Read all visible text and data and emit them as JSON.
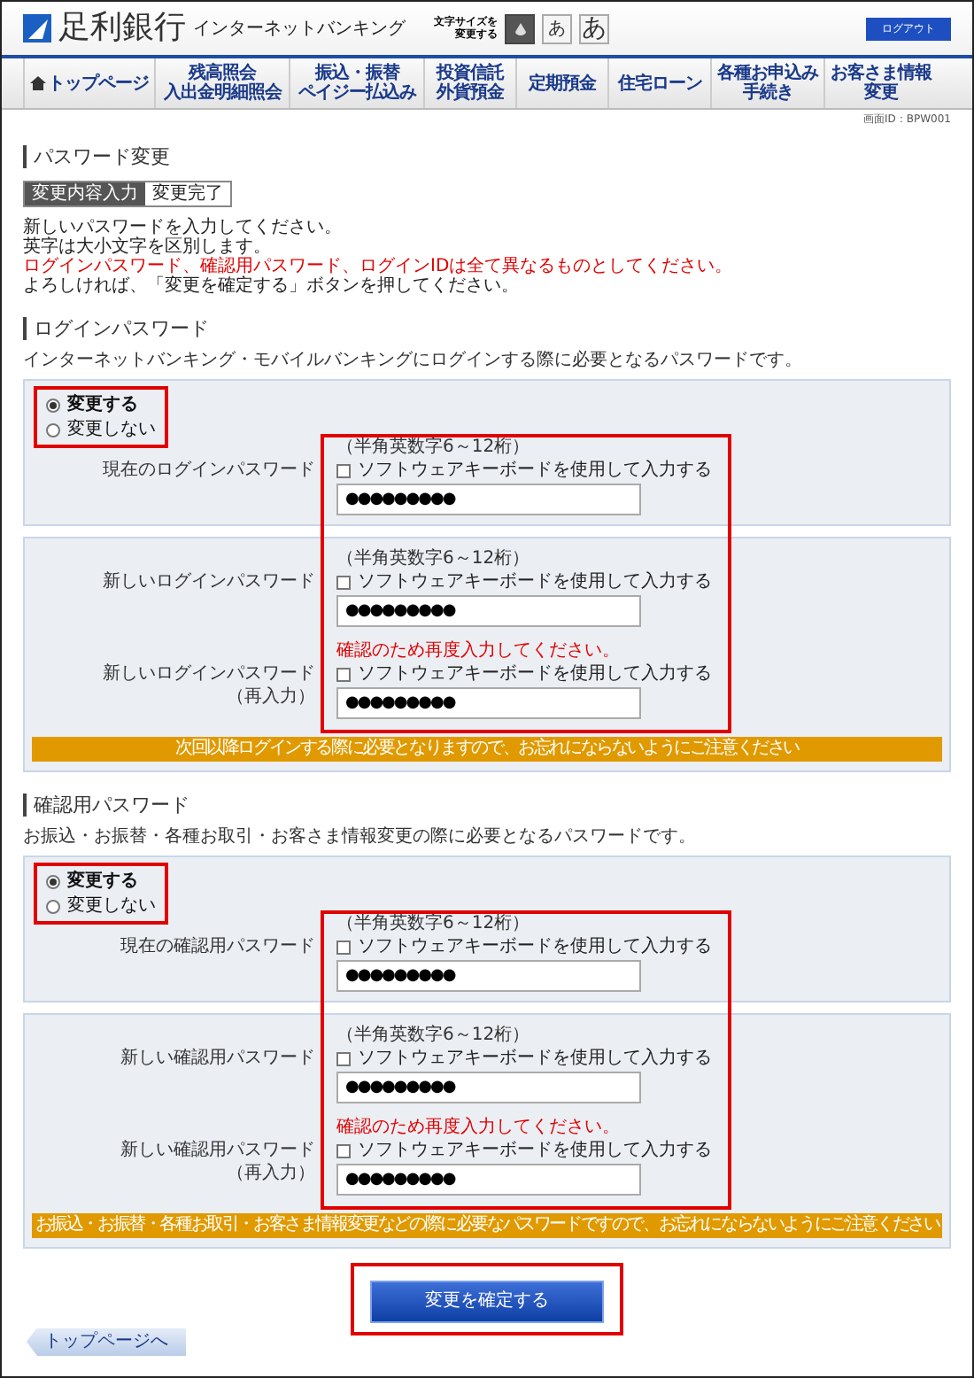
{
  "header": {
    "bank_name": "足利銀行",
    "service_name": "インターネットバンキング",
    "font_size_label": [
      "文字サイズを",
      "変更する"
    ],
    "font_size_buttons": [
      {
        "kind": "icon",
        "selected": true
      },
      {
        "kind": "small",
        "label": "あ",
        "selected": false
      },
      {
        "kind": "large",
        "label": "あ",
        "selected": false
      }
    ],
    "logout": "ログアウト"
  },
  "nav": [
    {
      "kind": "home",
      "lines": [
        "トップページ"
      ]
    },
    {
      "lines": [
        "残高照会",
        "入出金明細照会"
      ]
    },
    {
      "lines": [
        "振込・振替",
        "ペイジー払込み"
      ]
    },
    {
      "lines": [
        "投資信託",
        "外貨預金"
      ]
    },
    {
      "lines": [
        "定期預金"
      ]
    },
    {
      "lines": [
        "住宅ローン"
      ]
    },
    {
      "lines": [
        "各種お申込み",
        "手続き"
      ]
    },
    {
      "lines": [
        "お客さま情報",
        "変更"
      ]
    }
  ],
  "screen_id": "画面ID：BPW001",
  "title": "パスワード変更",
  "steps": [
    {
      "label": "変更内容入力",
      "selected": true
    },
    {
      "label": "変更完了",
      "selected": false
    }
  ],
  "instructions": [
    {
      "kind": "normal",
      "text": "新しいパスワードを入力してください。"
    },
    {
      "kind": "normal",
      "text": "英字は大小文字を区別します。"
    },
    {
      "kind": "warning",
      "text": "ログインパスワード、確認用パスワード、ログインIDは全て異なるものとしてください。"
    },
    {
      "kind": "normal",
      "text": "よろしければ、「変更を確定する」ボタンを押してください。"
    }
  ],
  "sections": [
    {
      "heading": "ログインパスワード",
      "description": "インターネットバンキング・モバイルバンキングにログインする際に必要となるパスワードです。",
      "radios": [
        {
          "label": "変更する",
          "selected": true
        },
        {
          "label": "変更しない",
          "selected": false
        }
      ],
      "current": {
        "kind": "entry",
        "label": [
          "現在のログインパスワード"
        ],
        "hint": "（半角英数字6～12桁）",
        "keyboard_label": "ソフトウェアキーボードを使用して入力する",
        "checked": false,
        "value": "●●●●●●●●●"
      },
      "new_fields": [
        {
          "kind": "entry",
          "label": [
            "新しいログインパスワード"
          ],
          "hint": "（半角英数字6～12桁）",
          "keyboard_label": "ソフトウェアキーボードを使用して入力する",
          "checked": false,
          "value": "●●●●●●●●●"
        },
        {
          "kind": "confirm",
          "label": [
            "新しいログインパスワード",
            "（再入力）"
          ],
          "hint": "確認のため再度入力してください。",
          "keyboard_label": "ソフトウェアキーボードを使用して入力する",
          "checked": false,
          "value": "●●●●●●●●●"
        }
      ],
      "notice": "次回以降ログインする際に必要となりますので、お忘れにならないようにご注意ください"
    },
    {
      "heading": "確認用パスワード",
      "description": "お振込・お振替・各種お取引・お客さま情報変更の際に必要となるパスワードです。",
      "radios": [
        {
          "label": "変更する",
          "selected": true
        },
        {
          "label": "変更しない",
          "selected": false
        }
      ],
      "current": {
        "kind": "entry",
        "label": [
          "現在の確認用パスワード"
        ],
        "hint": "（半角英数字6～12桁）",
        "keyboard_label": "ソフトウェアキーボードを使用して入力する",
        "checked": false,
        "value": "●●●●●●●●●"
      },
      "new_fields": [
        {
          "kind": "entry",
          "label": [
            "新しい確認用パスワード"
          ],
          "hint": "（半角英数字6～12桁）",
          "keyboard_label": "ソフトウェアキーボードを使用して入力する",
          "checked": false,
          "value": "●●●●●●●●●"
        },
        {
          "kind": "confirm",
          "label": [
            "新しい確認用パスワード",
            "（再入力）"
          ],
          "hint": "確認のため再度入力してください。",
          "keyboard_label": "ソフトウェアキーボードを使用して入力する",
          "checked": false,
          "value": "●●●●●●●●●"
        }
      ],
      "notice": "お振込・お振替・各種お取引・お客さま情報変更などの際に必要なパスワードですので、お忘れにならないようにご注意ください"
    }
  ],
  "submit": "変更を確定する",
  "back": "トップページへ"
}
